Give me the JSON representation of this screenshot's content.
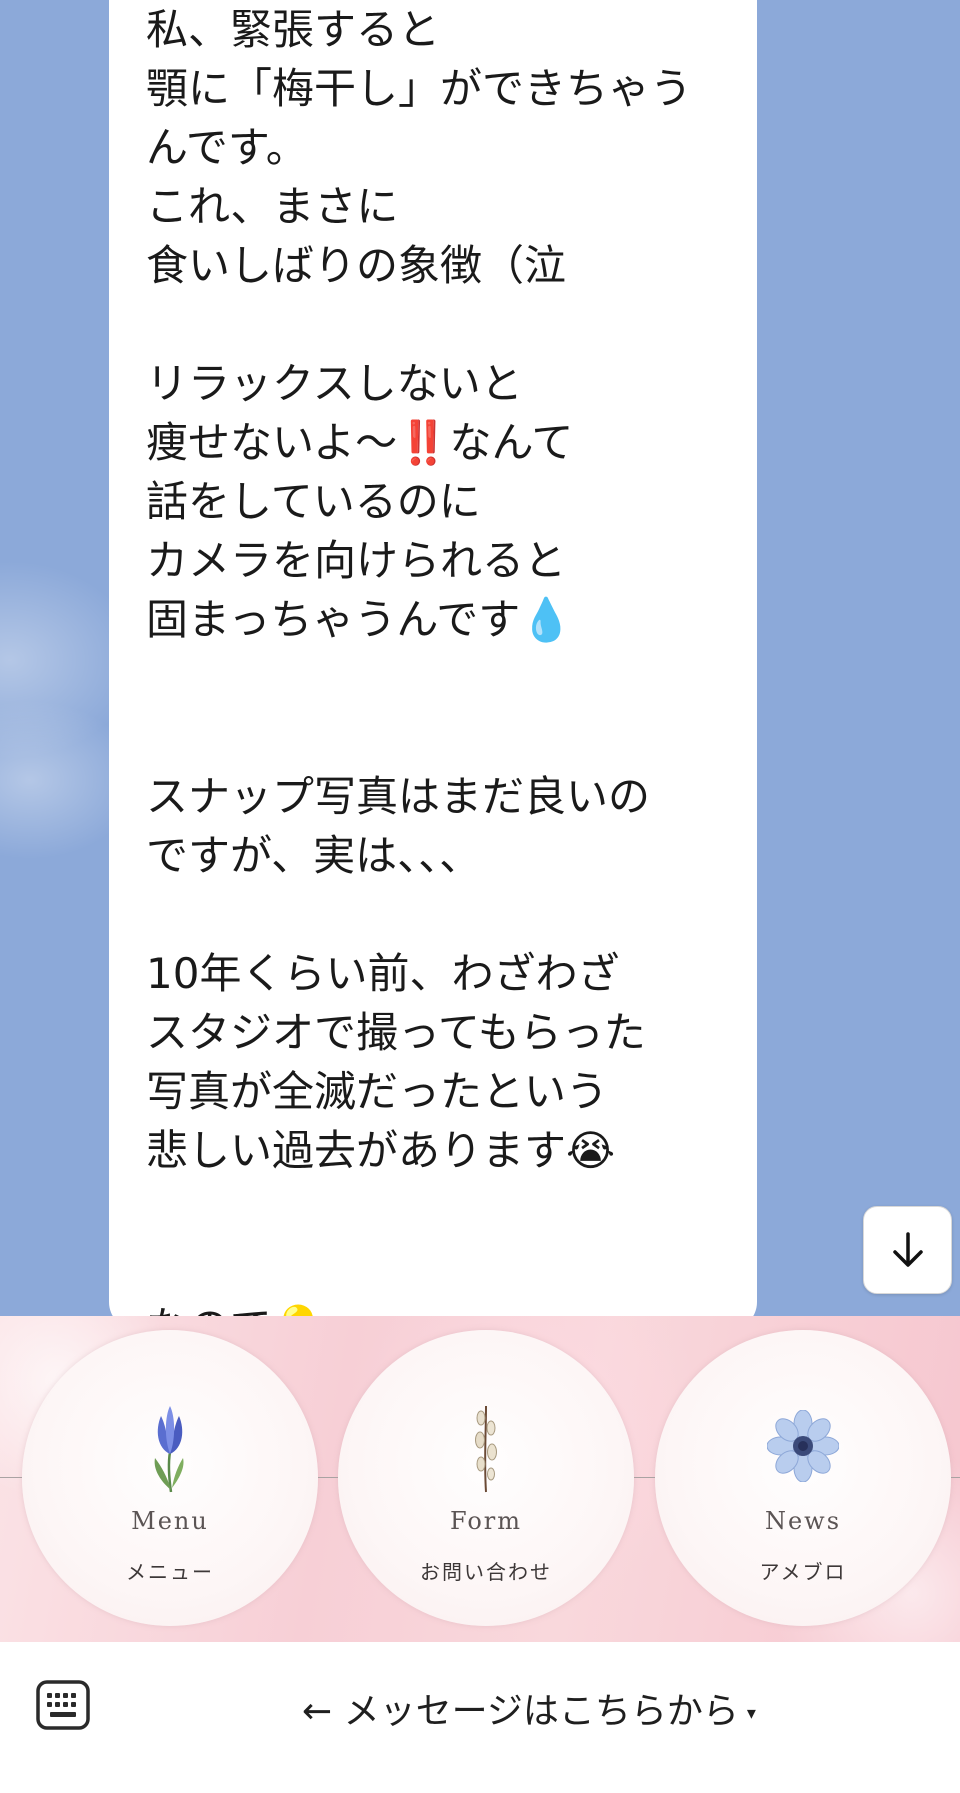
{
  "chat": {
    "message_lines": [
      "私、緊張すると",
      "顎に「梅干し」ができちゃう",
      "んです。",
      "これ、まさに",
      "食いしばりの象徴（泣",
      "",
      "リラックスしないと",
      "痩せないよ〜‼️なんて",
      "話をしているのに",
      "カメラを向けられると",
      "固まっちゃうんです💧",
      "",
      "",
      "スナップ写真はまだ良いの",
      "ですが、実は、、、",
      "",
      "10年くらい前、わざわざ",
      "スタジオで撮ってもらった",
      "写真が全滅だったという",
      "悲しい過去があります😭",
      "",
      "",
      "なので💡"
    ]
  },
  "scroll_button": {
    "icon": "arrow-down-icon"
  },
  "rich_menu": {
    "items": [
      {
        "title": "Menu",
        "subtitle": "メニュー",
        "icon": "crocus-flower-icon"
      },
      {
        "title": "Form",
        "subtitle": "お問い合わせ",
        "icon": "willow-branch-icon"
      },
      {
        "title": "News",
        "subtitle": "アメブロ",
        "icon": "anemone-flower-icon"
      }
    ]
  },
  "bottom_bar": {
    "label": "← メッセージはこちらから",
    "caret": "▾",
    "keyboard_icon": "keyboard-icon"
  },
  "colors": {
    "chat_background": "#8ca9d9",
    "bubble": "#ffffff",
    "menu_background": "#f7cfd6"
  }
}
